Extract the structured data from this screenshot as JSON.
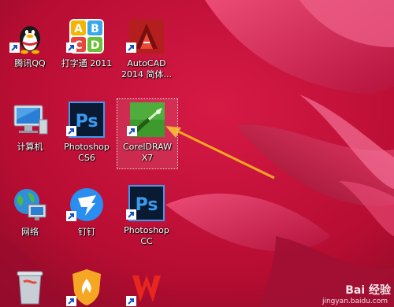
{
  "desktop": {
    "icons": [
      {
        "label": "腾讯QQ",
        "icon": "qq-penguin-icon"
      },
      {
        "label": "打字通 2011",
        "icon": "typing-abcd-icon"
      },
      {
        "label": "AutoCAD 2014 简体...",
        "icon": "autocad-icon"
      },
      {
        "label": "计算机",
        "icon": "computer-monitor-icon"
      },
      {
        "label": "Photoshop CS6",
        "icon": "photoshop-icon"
      },
      {
        "label": "CorelDRAW X7",
        "icon": "coreldraw-icon"
      },
      {
        "label": "网络",
        "icon": "network-globe-icon"
      },
      {
        "label": "钉钉",
        "icon": "dingtalk-icon"
      },
      {
        "label": "Photoshop CC",
        "icon": "photoshop-icon"
      },
      {
        "label": "",
        "icon": "recycle-bin-icon"
      },
      {
        "label": "",
        "icon": "shield-flame-icon"
      },
      {
        "label": "",
        "icon": "wps-office-icon"
      }
    ],
    "selected": "CorelDRAW X7",
    "annotation": "orange-arrow-icon"
  },
  "watermark": {
    "logo": "Bai 经验",
    "url": "jingyan.baidu.com"
  },
  "colors": {
    "wallpaper": "#c5123c",
    "petal": "#e0285a",
    "arrow": "#f5a623",
    "photoshop_bg": "#0a1a33",
    "photoshop_text": "#3a9bf0",
    "coreldraw": "#3f9a2e"
  }
}
